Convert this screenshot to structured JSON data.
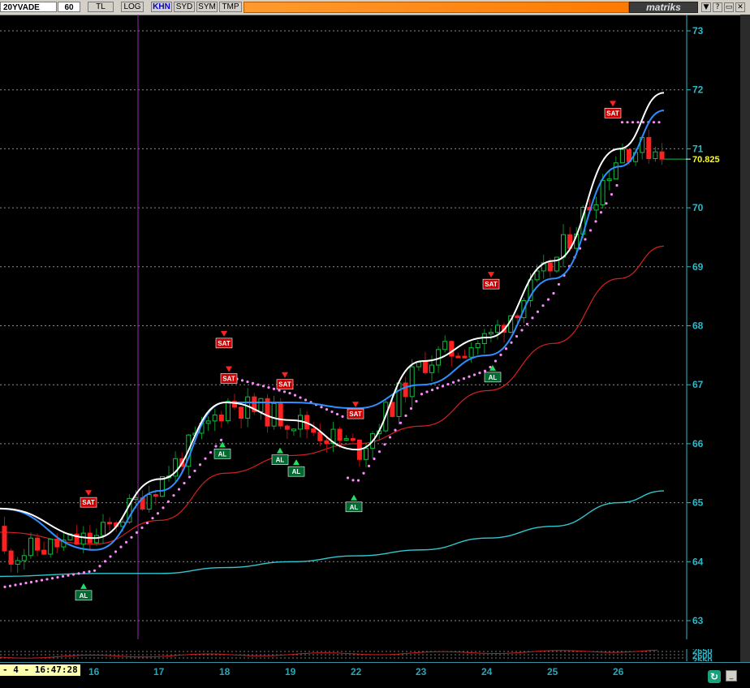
{
  "toolbar": {
    "symbol": "20YVADE",
    "period": "60",
    "buttons": [
      "TL",
      "LOG",
      "KHN",
      "SYD",
      "SYM",
      "TMP"
    ],
    "active_button": "KHN",
    "brand": "matriks"
  },
  "price_axis": {
    "labels": [
      "73",
      "72",
      "71",
      "70",
      "69",
      "68",
      "67",
      "66",
      "65",
      "64",
      "63"
    ],
    "last_price": "70.825"
  },
  "indicator_axis": {
    "labels": [
      "2650",
      "2600",
      "2550",
      "2500"
    ]
  },
  "date_axis": {
    "datetime": "- 4 - 16:47:28",
    "labels": [
      "16",
      "17",
      "18",
      "19",
      "22",
      "23",
      "24",
      "25",
      "26"
    ]
  },
  "signals": {
    "buy_label": "AL",
    "sell_label": "SAT"
  },
  "colors": {
    "up_candle": "#10c040",
    "down_candle": "#ff2020",
    "white_line": "#ffffff",
    "blue_line": "#2f8fff",
    "red_ma": "#d42020",
    "cyan_ma": "#30c8d0",
    "sar_dots": "#ff88ff",
    "axis": "#30b8c8",
    "brand_bar": "#ff8800"
  },
  "chart_data": {
    "type": "line",
    "title": "",
    "ylim": [
      63,
      73
    ],
    "x": [
      "16",
      "17",
      "18",
      "19",
      "22",
      "23",
      "24",
      "25",
      "26"
    ],
    "series": [
      {
        "values": [
          64.4,
          65.4,
          66.7,
          66.4,
          65.9,
          67.4,
          67.8,
          69.1,
          71.0
        ]
      },
      {
        "values": [
          64.2,
          65.2,
          66.7,
          66.7,
          66.6,
          67.0,
          67.5,
          68.8,
          70.7
        ]
      },
      {
        "values": [
          64.3,
          64.7,
          65.5,
          65.8,
          66.0,
          66.3,
          66.9,
          67.7,
          68.8
        ]
      },
      {
        "values": [
          63.8,
          63.8,
          63.9,
          64.0,
          64.1,
          64.2,
          64.4,
          64.6,
          65.0
        ]
      }
    ],
    "signals_chart": {
      "sell": [
        [
          "16",
          64.8
        ],
        [
          "18",
          67.5
        ],
        [
          "18",
          66.9
        ],
        [
          "19",
          66.8
        ],
        [
          "22",
          66.3
        ],
        [
          "24",
          68.5
        ],
        [
          "26",
          71.4
        ]
      ],
      "buy": [
        [
          "16",
          63.8
        ],
        [
          "18",
          66.2
        ],
        [
          "19",
          65.9
        ],
        [
          "19",
          66.1
        ],
        [
          "22",
          65.3
        ],
        [
          "24",
          67.5
        ]
      ]
    }
  }
}
